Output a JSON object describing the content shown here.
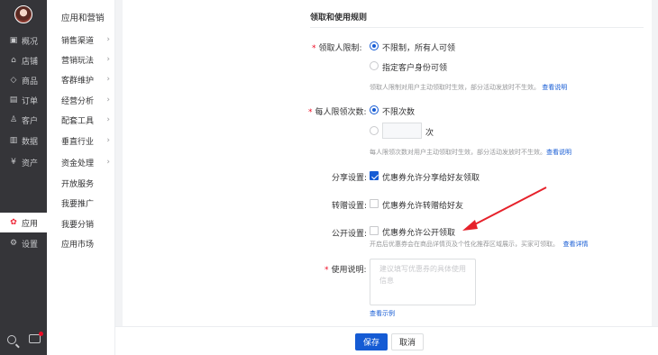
{
  "nav": {
    "items": [
      {
        "icon": "overview-icon",
        "glyph": "▣",
        "label": "概况"
      },
      {
        "icon": "store-icon",
        "glyph": "⌂",
        "label": "店铺"
      },
      {
        "icon": "goods-icon",
        "glyph": "◇",
        "label": "商品"
      },
      {
        "icon": "order-icon",
        "glyph": "▤",
        "label": "订单"
      },
      {
        "icon": "customer-icon",
        "glyph": "♙",
        "label": "客户"
      },
      {
        "icon": "data-icon",
        "glyph": "▥",
        "label": "数据"
      },
      {
        "icon": "assets-icon",
        "glyph": "¥",
        "label": "资产"
      },
      {
        "icon": "apps-icon",
        "glyph": "✿",
        "label": "应用"
      },
      {
        "icon": "settings-icon",
        "glyph": "⚙",
        "label": "设置"
      }
    ]
  },
  "submenu": {
    "title": "应用和营销",
    "items": [
      {
        "label": "销售渠道",
        "chev": "›"
      },
      {
        "label": "营销玩法",
        "chev": "›"
      },
      {
        "label": "客群维护",
        "chev": "›"
      },
      {
        "label": "经营分析",
        "chev": "›"
      },
      {
        "label": "配套工具",
        "chev": "›"
      },
      {
        "label": "垂直行业",
        "chev": "›"
      },
      {
        "label": "资金处理",
        "chev": "›"
      },
      {
        "label": "开放服务",
        "chev": ""
      },
      {
        "label": "我要推广",
        "chev": ""
      },
      {
        "label": "我要分销",
        "chev": ""
      },
      {
        "label": "应用市场",
        "chev": ""
      }
    ]
  },
  "form": {
    "section_title": "领取和使用规则",
    "limit_label": "领取人限制:",
    "limit_opt1": "不限制，所有人可领",
    "limit_opt2": "指定客户身份可领",
    "limit_hint": "领取人限制对用户主动领取时生效，部分活动发放时不生效。",
    "limit_hint_link": "查看说明",
    "per_label": "每人限领次数:",
    "per_opt1": "不限次数",
    "per_unit": "次",
    "per_hint": "每人限领次数对用户主动领取时生效，部分活动发放时不生效。",
    "per_hint_link": "查看说明",
    "share_label": "分享设置:",
    "share_text": "优惠券允许分享给好友领取",
    "transfer_label": "转赠设置:",
    "transfer_text": "优惠券允许转赠给好友",
    "public_label": "公开设置:",
    "public_text": "优惠券允许公开领取",
    "public_hint": "开启后优惠券会在商品详情页及个性化推荐区域展示，买家可领取。",
    "public_hint_link": "查看详情",
    "usage_label": "使用说明:",
    "usage_placeholder": "建议填写优惠券的具体使用信息",
    "usage_example_link": "查看示例"
  },
  "footer": {
    "save": "保存",
    "cancel": "取消"
  },
  "colors": {
    "primary": "#155bd4",
    "required": "#ee0a24",
    "annotation_arrow": "#e6212a"
  }
}
